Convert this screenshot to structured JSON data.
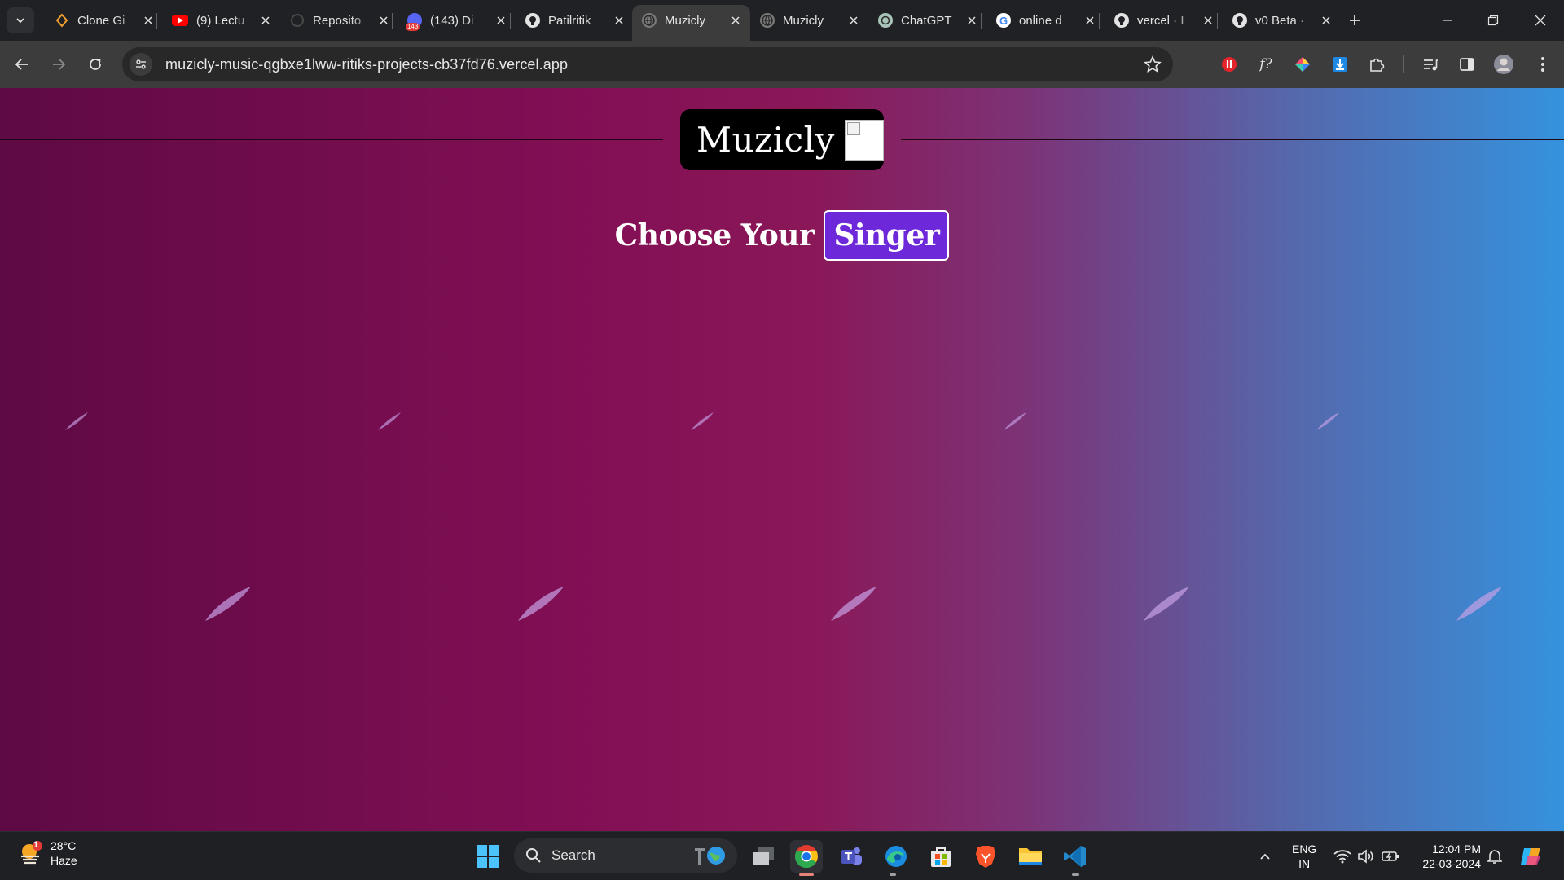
{
  "browser": {
    "tabs": [
      {
        "title": "Clone Gi",
        "icon": "diamond-favicon",
        "active": false
      },
      {
        "title": "(9) Lectu",
        "icon": "youtube-favicon",
        "active": false
      },
      {
        "title": "Reposito",
        "icon": "loading-favicon",
        "active": false
      },
      {
        "title": "(143) Di",
        "icon": "badge-favicon",
        "badge": "143",
        "active": false
      },
      {
        "title": "Patilritik",
        "icon": "github-favicon",
        "active": false
      },
      {
        "title": "Muzicly",
        "icon": "globe-favicon",
        "active": true
      },
      {
        "title": "Muzicly",
        "icon": "globe-favicon",
        "active": false
      },
      {
        "title": "ChatGPT",
        "icon": "chatgpt-favicon",
        "active": false
      },
      {
        "title": "online d",
        "icon": "google-favicon",
        "active": false
      },
      {
        "title": "vercel · I",
        "icon": "github-favicon",
        "active": false
      },
      {
        "title": "v0 Beta ·",
        "icon": "github-favicon",
        "active": false
      }
    ],
    "url": "muzicly-music-qgbxe1lww-ritiks-projects-cb37fd76.vercel.app"
  },
  "page": {
    "logo_text": "Muzicly",
    "heading": "Choose Your",
    "button_label": "Singer",
    "colors": {
      "gradient_start": "#5e0a44",
      "gradient_mid": "#8a1858",
      "gradient_end": "#3592dd",
      "button_bg": "#6d28d9"
    }
  },
  "taskbar": {
    "weather_badge": "1",
    "temperature": "28°C",
    "condition": "Haze",
    "search_label": "Search",
    "lang_top": "ENG",
    "lang_bottom": "IN",
    "time": "12:04 PM",
    "date": "22-03-2024"
  }
}
